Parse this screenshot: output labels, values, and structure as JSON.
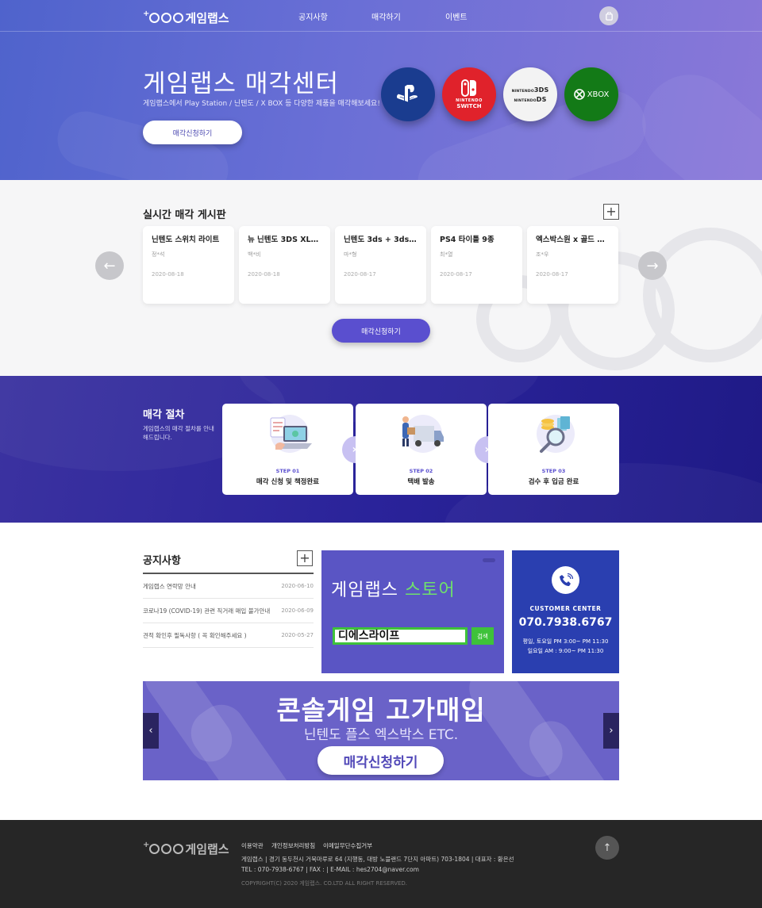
{
  "header": {
    "logo_text": "게임랩스",
    "nav": [
      "공지사항",
      "매각하기",
      "이벤트"
    ],
    "cart_icon": "bag-icon"
  },
  "hero": {
    "title": "게임랩스 매각센터",
    "subtitle": "게임랩스에서 Play Station / 닌텐도 / X BOX 등 다양한 제품을 매각해보세요!",
    "button": "매각신청하기",
    "consoles": [
      {
        "name": "playstation-logo",
        "label": "PS",
        "color": "#1a3c8f"
      },
      {
        "name": "nintendo-switch-logo",
        "label": "NINTENDO SWITCH",
        "color": "#e0222b"
      },
      {
        "name": "nintendo-3ds-logo",
        "label": "NINTENDO 3DS / NINTENDO DS",
        "color": "#f3f3f3"
      },
      {
        "name": "xbox-logo",
        "label": "XBOX",
        "color": "#137a17"
      }
    ]
  },
  "board": {
    "title": "실시간 매각 게시판",
    "button": "매각신청하기",
    "cards": [
      {
        "title": "닌텐도 스위치 라이트",
        "author": "정*석",
        "date": "2020-08-18"
      },
      {
        "title": "뉴 닌텐도 3DS XL+...",
        "author": "백*비",
        "date": "2020-08-18"
      },
      {
        "title": "닌텐도 3ds + 3ds 마...",
        "author": "마*형",
        "date": "2020-08-17"
      },
      {
        "title": "PS4 타이틀 9종",
        "author": "최*열",
        "date": "2020-08-17"
      },
      {
        "title": "엑스박스원 x 골드 베...",
        "author": "조*우",
        "date": "2020-08-17"
      }
    ]
  },
  "process": {
    "title": "매각 절차",
    "subtitle": "게임랩스의 매각 절차를 안내해드립니다.",
    "steps": [
      {
        "no": "STEP 01",
        "name": "매각 신청 및 책정완료"
      },
      {
        "no": "STEP 02",
        "name": "택배 발송"
      },
      {
        "no": "STEP 03",
        "name": "검수 후 입금 완료"
      }
    ]
  },
  "notice": {
    "title": "공지사항",
    "items": [
      {
        "title": "게임랩스 연락망 안내",
        "date": "2020-06-10"
      },
      {
        "title": "코로나19 (COVID-19) 관련 직거래 매입 불가안내",
        "date": "2020-06-09"
      },
      {
        "title": "견적 확인후 필독사항 ( 꼭 확인해주세요 )",
        "date": "2020-05-27"
      }
    ]
  },
  "store": {
    "title_a": "게임랩스 ",
    "title_b": "스토어",
    "search_value": "디에스라이프",
    "search_button": "검색"
  },
  "customer": {
    "label": "CUSTOMER CENTER",
    "phone": "070.7938.6767",
    "hours1": "평일, 토요일 PM 3:00~ PM 11:30",
    "hours2": "일요일 AM : 9:00~ PM 11:30"
  },
  "banner": {
    "title": "콘솔게임 고가매입",
    "subtitle": "닌텐도 플스 엑스박스 ETC.",
    "button": "매각신청하기"
  },
  "footer": {
    "links": [
      "이용약관",
      "개인정보처리방침",
      "이메일무단수집거부"
    ],
    "info1": "게임랩스   |   경기 동두천시 거북마루로 64 (지행동, 대방 노블랜드 7단지 아파트) 703-1804   |   대표자 : 황은선",
    "info2": "TEL : 070-7938-6767   |   FAX :    |   E-MAIL : hes2704@naver.com",
    "copyright": "COPYRIGHT(C) 2020 게임랩스. CO.LTD ALL RIGHT RESERVED."
  }
}
